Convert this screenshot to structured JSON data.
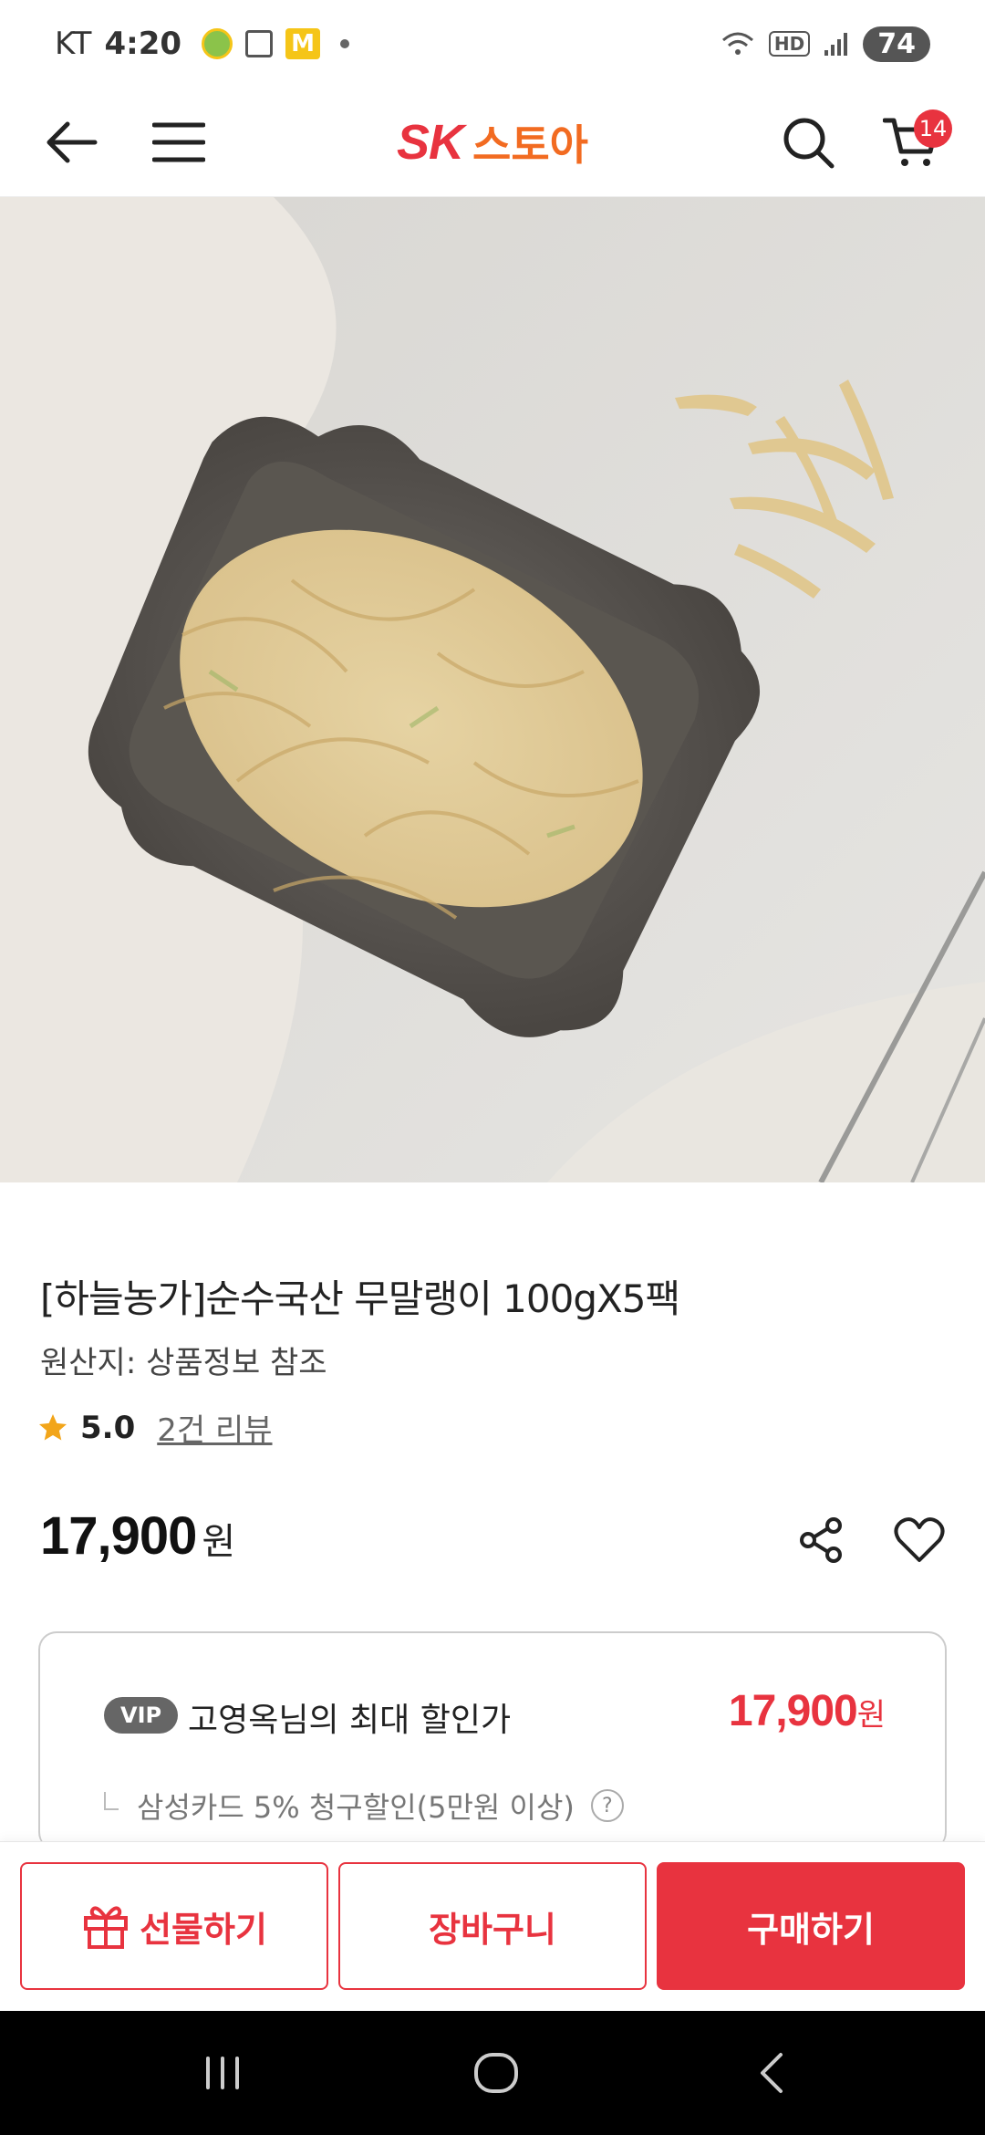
{
  "status_bar": {
    "carrier": "KT",
    "time": "4:20",
    "hd_label": "HD",
    "battery": "74"
  },
  "header": {
    "logo_sk": "SK",
    "logo_text": "스토아",
    "cart_count": "14"
  },
  "product": {
    "title": "[하늘농가]순수국산 무말랭이 100gX5팩",
    "origin": "원산지: 상품정보 참조",
    "rating": "5.0",
    "review_link": "2건 리뷰",
    "price": "17,900",
    "currency": "원"
  },
  "discount": {
    "badge": "VIP",
    "label": "고영옥님의 최대 할인가",
    "price": "17,900",
    "currency": "원",
    "card_offer": "삼성카드 5% 청구할인(5만원 이상)",
    "help": "?"
  },
  "actions": {
    "gift": "선물하기",
    "cart": "장바구니",
    "buy": "구매하기"
  },
  "colors": {
    "brand_red": "#e8333f",
    "brand_orange": "#f26b21"
  }
}
